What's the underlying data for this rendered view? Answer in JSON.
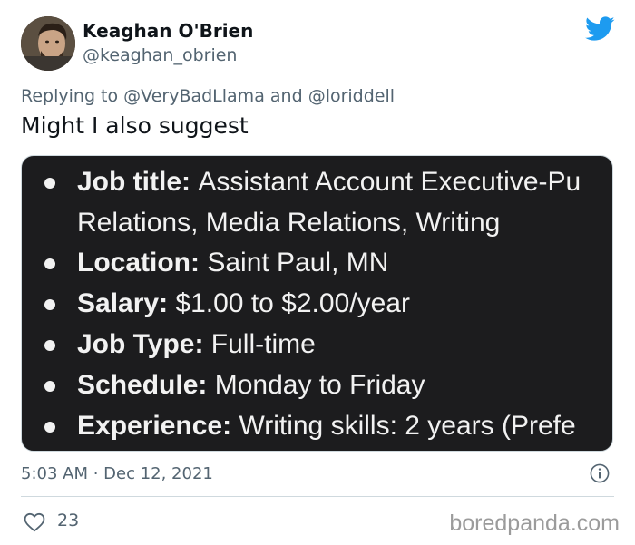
{
  "tweet": {
    "author": {
      "name": "Keaghan O'Brien",
      "handle": "@keaghan_obrien"
    },
    "reply": {
      "prefix": "Replying to",
      "mention1": "@VeryBadLlama",
      "conjunction": "and",
      "mention2": "@loriddell"
    },
    "text": "Might I also suggest",
    "timestamp": "5:03 AM · Dec 12, 2021",
    "likes": "23",
    "icons": {
      "brand": "twitter-bird-icon",
      "info": "info-icon",
      "like": "heart-icon"
    },
    "colors": {
      "brand": "#1d9bf0",
      "secondary_text": "#536471",
      "media_bg": "#1c1c1e"
    }
  },
  "media": {
    "items": [
      {
        "label": "Job title:",
        "value": "Assistant Account Executive-Pu",
        "continuation": "Relations, Media Relations, Writing"
      },
      {
        "label": "Location:",
        "value": "Saint Paul, MN"
      },
      {
        "label": "Salary:",
        "value": "$1.00 to $2.00/year"
      },
      {
        "label": "Job Type:",
        "value": "Full-time"
      },
      {
        "label": "Schedule:",
        "value": "Monday to Friday"
      },
      {
        "label": "Experience:",
        "value": "Writing skills: 2 years (Prefe"
      }
    ]
  },
  "watermark": "boredpanda.com"
}
